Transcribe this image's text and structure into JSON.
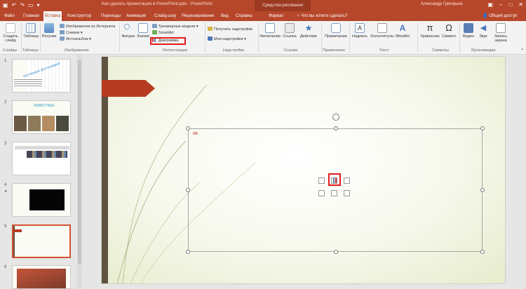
{
  "titlebar": {
    "title": "Как сделать презентацию в PowerPoint.pptx - PowerPoint",
    "context_group": "Средства рисования",
    "user": "Александр Григорьев"
  },
  "tabs": [
    "Файл",
    "Главная",
    "Вставка",
    "Конструктор",
    "Переходы",
    "Анимация",
    "Слайд-шоу",
    "Рецензирование",
    "Вид",
    "Справка",
    "Формат"
  ],
  "active_tab": "Вставка",
  "tell_me": "Что вы хотите сделать?",
  "share": "Общий доступ",
  "ribbon": {
    "slides": {
      "new_slide": "Создать слайд",
      "label": "Слайды"
    },
    "tables": {
      "table": "Таблица",
      "label": "Таблицы"
    },
    "images": {
      "pictures": "Рисунки",
      "online": "Изображения из Интернета",
      "screenshot": "Снимок",
      "album": "Фотоальбом",
      "label": "Изображения"
    },
    "illustrations": {
      "shapes": "Фигуры",
      "icons": "Значки",
      "models": "Трехмерные модели",
      "smartart": "SmartArt",
      "chart": "Диаграмма",
      "label": "Иллюстрации"
    },
    "addins": {
      "get": "Получить надстройки",
      "my": "Мои надстройки",
      "label": "Надстройки"
    },
    "links": {
      "zoom": "Увеличение",
      "link": "Ссылка",
      "action": "Действие",
      "label": "Ссылки"
    },
    "comments": {
      "comment": "Примечание",
      "label": "Примечания"
    },
    "text": {
      "textbox": "Надпись",
      "header": "Колонтитулы",
      "wordart": "WordArt",
      "label": "Текст"
    },
    "symbols": {
      "equation": "Уравнение",
      "symbol": "Символ",
      "label": "Символы"
    },
    "media": {
      "video": "Видео",
      "audio": "Звук",
      "record": "Запись экрана",
      "label": "Мультимедиа"
    }
  },
  "slides_panel": {
    "numbers": [
      "1",
      "2",
      "3",
      "4",
      "5",
      "6"
    ],
    "thumb1_text": "Коллекция фотографий",
    "thumb2_text": "ЖИВОТНЫЕ"
  },
  "colors": {
    "accent": "#b7472a",
    "highlight": "#e01b1b",
    "banner": "#b63b22"
  }
}
